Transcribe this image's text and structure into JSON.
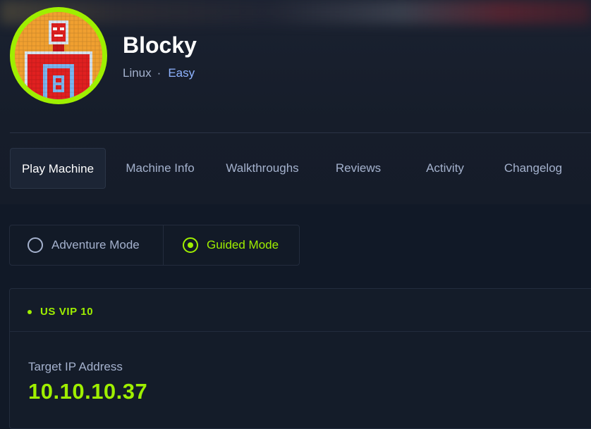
{
  "machine": {
    "name": "Blocky",
    "os": "Linux",
    "separator": "·",
    "difficulty": "Easy",
    "avatar_icon": "pixel-robot-avatar-icon"
  },
  "tabs": [
    {
      "label": "Play Machine",
      "active": true
    },
    {
      "label": "Machine Info",
      "active": false
    },
    {
      "label": "Walkthroughs",
      "active": false
    },
    {
      "label": "Reviews",
      "active": false
    },
    {
      "label": "Activity",
      "active": false
    },
    {
      "label": "Changelog",
      "active": false
    }
  ],
  "modes": {
    "adventure_label": "Adventure Mode",
    "guided_label": "Guided Mode",
    "selected": "Guided Mode"
  },
  "connection": {
    "server": "US VIP 10",
    "target_label": "Target IP Address",
    "target_ip": "10.10.10.37"
  },
  "colors": {
    "accent": "#9fef00",
    "background": "#111927",
    "muted_text": "#a4b1cd",
    "difficulty": "#8fb3ff"
  }
}
